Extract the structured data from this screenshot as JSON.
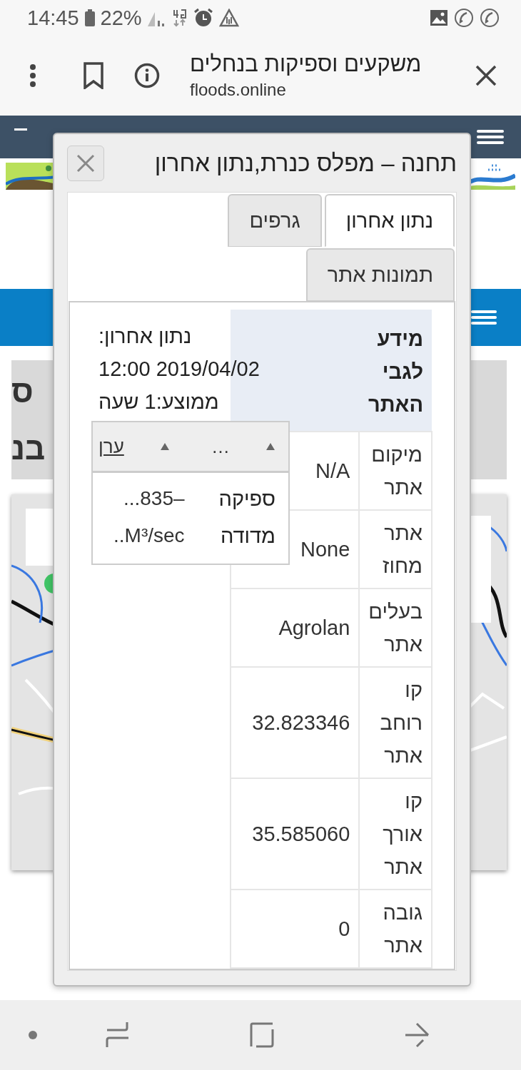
{
  "status_bar": {
    "time": "14:45",
    "battery": "22%"
  },
  "browser": {
    "title": "משקעים וספיקות בנחלים",
    "url": "floods.online"
  },
  "page": {
    "heading_lines": [
      "ס",
      "בנ"
    ]
  },
  "dialog": {
    "title": "תחנה – מפלס כנרת,נתון אחרון",
    "tabs": [
      {
        "label": "נתון אחרון",
        "selected": true
      },
      {
        "label": "גרפים",
        "selected": false
      },
      {
        "label": "תמונות אתר",
        "selected": false
      }
    ],
    "info_lines": [
      "נתון אחרון:",
      "12:00 2019/04/02",
      "ממוצע:1 שעה"
    ],
    "table": {
      "header": "מידע לגבי האתר",
      "rows": [
        {
          "label": "מיקום אתר",
          "value": "N/A"
        },
        {
          "label": "אתר מחוז",
          "value": "None"
        },
        {
          "label": "בעלים אתר",
          "value": "Agrolan"
        },
        {
          "label": "קו רוחב אתר",
          "value": "32.823346"
        },
        {
          "label": "קו אורך אתר",
          "value": "35.585060"
        },
        {
          "label": "גובה אתר",
          "value": "0"
        }
      ]
    },
    "grid": {
      "columns": [
        {
          "label": "…",
          "underlined": false
        },
        {
          "label": "ערן",
          "underlined": true
        }
      ],
      "row": {
        "label": "ספיקה מדודה",
        "value_lines": [
          "...835–",
          "..M³/sec"
        ]
      }
    }
  }
}
